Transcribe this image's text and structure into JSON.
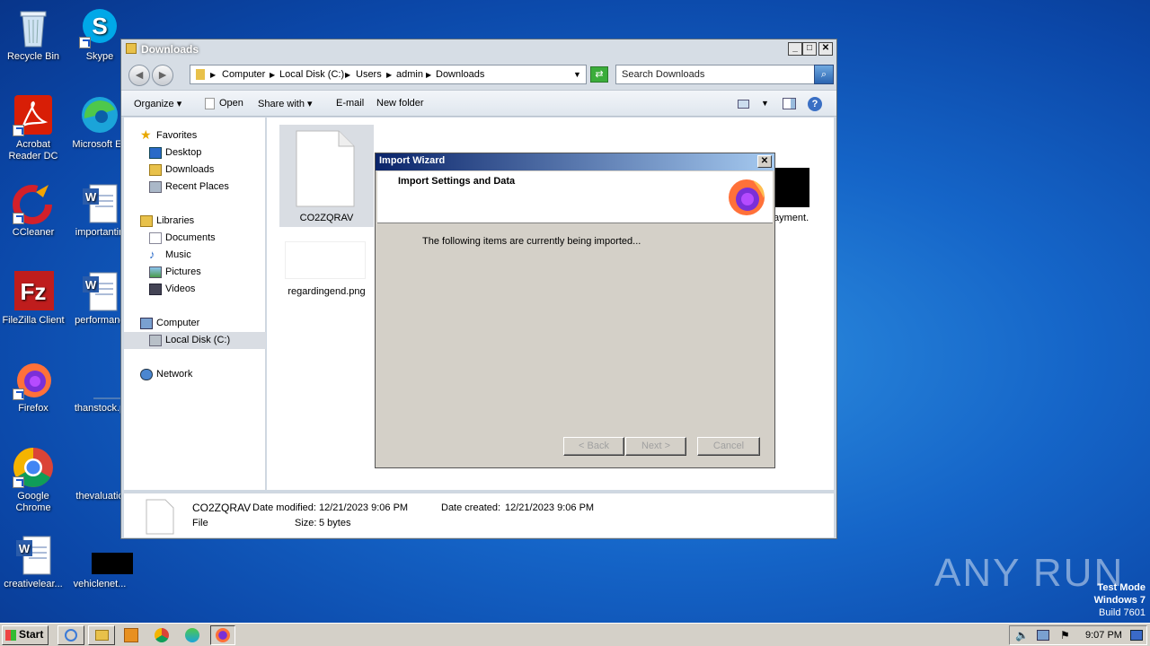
{
  "desktop": {
    "icons": [
      {
        "label": "Recycle Bin"
      },
      {
        "label": "Skype"
      },
      {
        "label": "Acrobat Reader DC"
      },
      {
        "label": "Microsoft Ed"
      },
      {
        "label": "CCleaner"
      },
      {
        "label": "importantin"
      },
      {
        "label": "FileZilla Client"
      },
      {
        "label": "performanc"
      },
      {
        "label": "Firefox"
      },
      {
        "label": "thanstock.p"
      },
      {
        "label": "Google Chrome"
      },
      {
        "label": "thevaluatio"
      },
      {
        "label": "creativelear..."
      },
      {
        "label": "vehiclenet..."
      }
    ],
    "watermark": "ANY RUN",
    "os_notice": {
      "line1": "Test Mode",
      "line2": "Windows 7",
      "line3": "Build 7601"
    }
  },
  "explorer": {
    "title": "Downloads",
    "breadcrumb": [
      "Computer",
      "Local Disk (C:)",
      "Users",
      "admin",
      "Downloads"
    ],
    "search_placeholder": "Search Downloads",
    "toolbar": {
      "organize": "Organize",
      "open": "Open",
      "share_with": "Share with",
      "email": "E-mail",
      "new_folder": "New folder"
    },
    "nav": {
      "favorites": "Favorites",
      "desktop": "Desktop",
      "downloads": "Downloads",
      "recent": "Recent Places",
      "libraries": "Libraries",
      "documents": "Documents",
      "music": "Music",
      "pictures": "Pictures",
      "videos": "Videos",
      "computer": "Computer",
      "local_disk": "Local Disk (C:)",
      "network": "Network"
    },
    "files": [
      {
        "name": "CO2ZQRAV"
      },
      {
        "name": "regardingend.png"
      },
      {
        "name": "ayment."
      }
    ],
    "details": {
      "name": "CO2ZQRAV",
      "type": "File",
      "modified_label": "Date modified:",
      "modified_value": "12/21/2023 9:06 PM",
      "created_label": "Date created:",
      "created_value": "12/21/2023 9:06 PM",
      "size_label": "Size:",
      "size_value": "5 bytes"
    }
  },
  "wizard": {
    "title": "Import Wizard",
    "heading": "Import Settings and Data",
    "message": "The following items are currently being imported...",
    "back": "< Back",
    "next": "Next >",
    "cancel": "Cancel"
  },
  "taskbar": {
    "start": "Start",
    "clock": "9:07 PM"
  }
}
